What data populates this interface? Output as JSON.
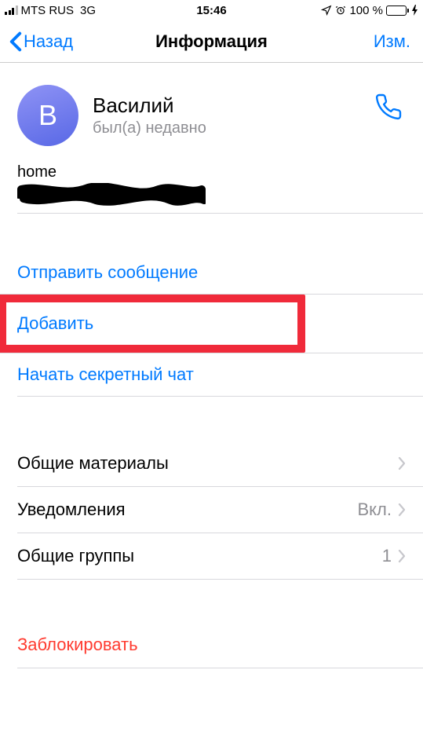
{
  "status": {
    "carrier": "MTS RUS",
    "network": "3G",
    "time": "15:46",
    "battery_text": "100 %"
  },
  "nav": {
    "back": "Назад",
    "title": "Информация",
    "edit": "Изм."
  },
  "profile": {
    "initial": "В",
    "name": "Василий",
    "status": "был(а) недавно"
  },
  "phone": {
    "label": "home"
  },
  "actions": {
    "send_message": "Отправить сообщение",
    "add": "Добавить",
    "secret_chat": "Начать секретный чат"
  },
  "settings": {
    "shared_media": "Общие материалы",
    "notifications": "Уведомления",
    "notifications_value": "Вкл.",
    "groups": "Общие группы",
    "groups_value": "1"
  },
  "block": {
    "label": "Заблокировать"
  }
}
